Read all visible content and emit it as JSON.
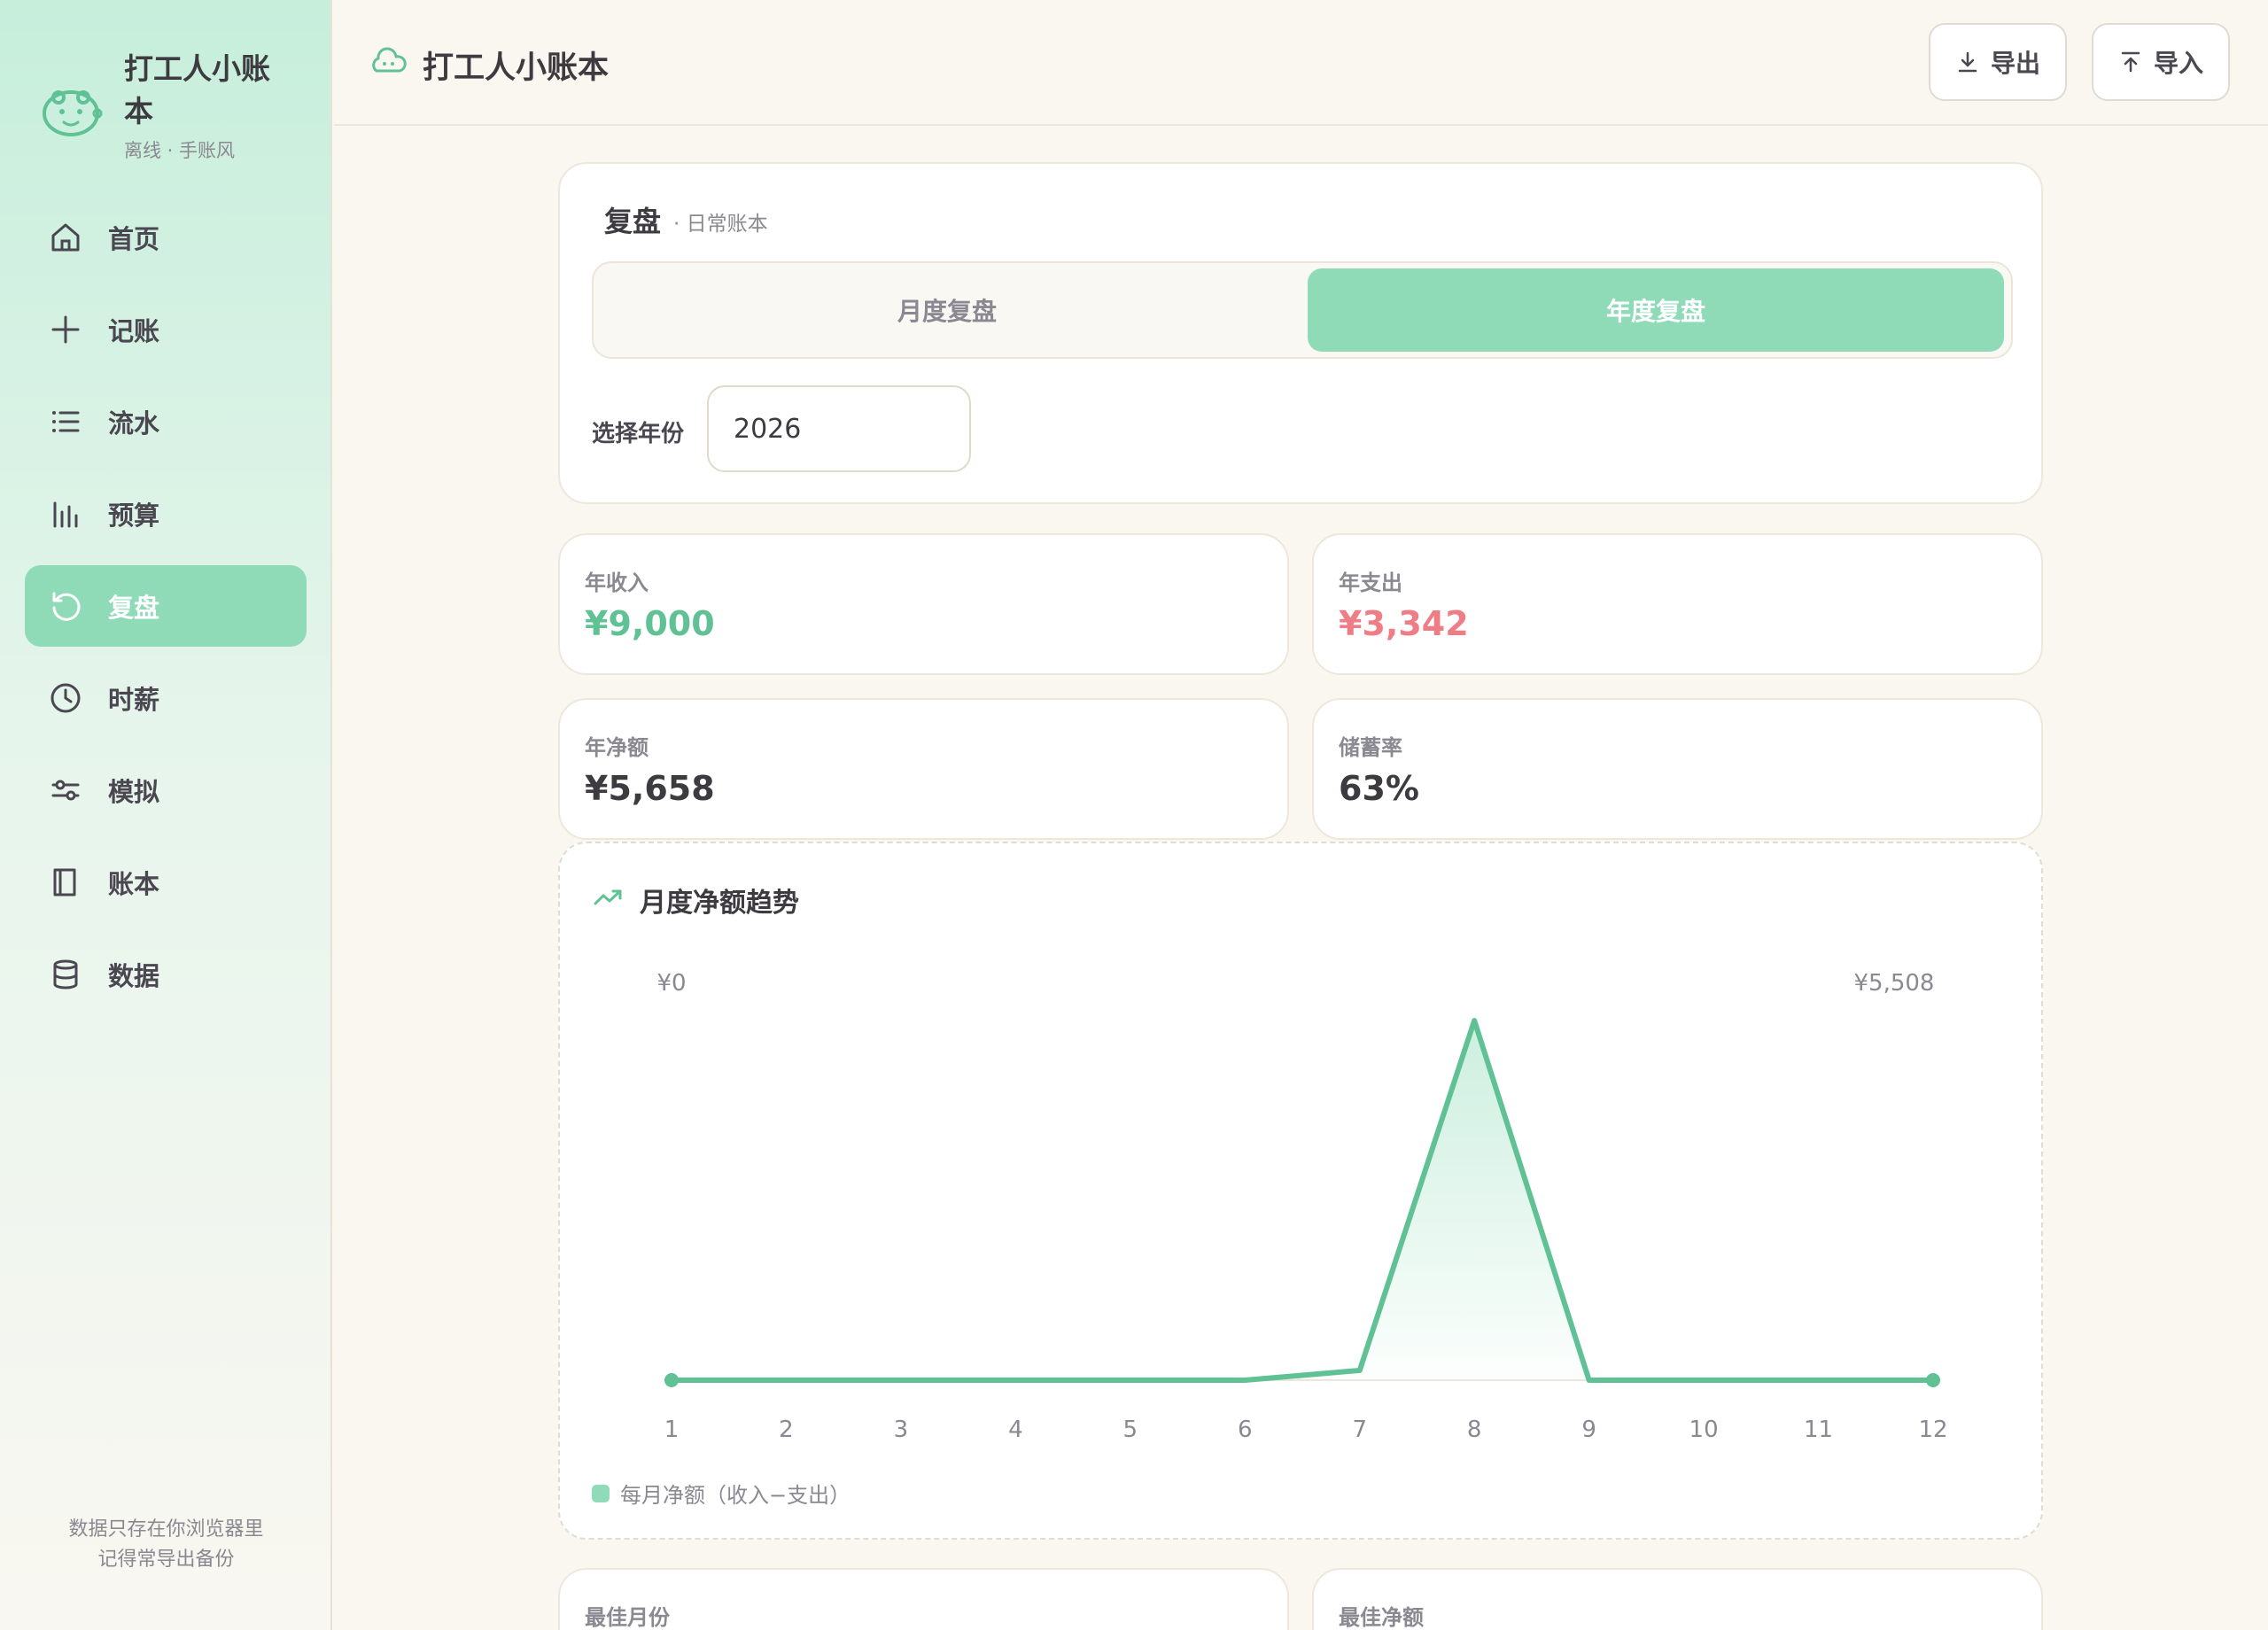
{
  "brand": {
    "title": "打工人小账本",
    "subtitle": "离线 · 手账风",
    "logo_icon": "smiley-face-icon"
  },
  "nav": [
    {
      "label": "首页",
      "icon": "home-icon",
      "active": false
    },
    {
      "label": "记账",
      "icon": "plus-icon",
      "active": false
    },
    {
      "label": "流水",
      "icon": "list-icon",
      "active": false
    },
    {
      "label": "预算",
      "icon": "bar-chart-icon",
      "active": false
    },
    {
      "label": "复盘",
      "icon": "refresh-icon",
      "active": true
    },
    {
      "label": "时薪",
      "icon": "clock-icon",
      "active": false
    },
    {
      "label": "模拟",
      "icon": "sliders-icon",
      "active": false
    },
    {
      "label": "账本",
      "icon": "book-icon",
      "active": false
    },
    {
      "label": "数据",
      "icon": "database-icon",
      "active": false
    }
  ],
  "sidebar_footer": {
    "line1": "数据只存在你浏览器里",
    "line2": "记得常导出备份"
  },
  "header": {
    "title": "打工人小账本",
    "export_label": "导出",
    "import_label": "导入"
  },
  "review": {
    "title": "复盘",
    "subtitle": "· 日常账本",
    "tabs": [
      {
        "label": "月度复盘",
        "active": false
      },
      {
        "label": "年度复盘",
        "active": true
      }
    ],
    "year_label": "选择年份",
    "year_value": "2026"
  },
  "stats": [
    {
      "label": "年收入",
      "value": "¥9,000",
      "color": "#5fc194"
    },
    {
      "label": "年支出",
      "value": "¥3,342",
      "color": "#ef7d86"
    },
    {
      "label": "年净额",
      "value": "¥5,658",
      "color": "#3d3a40"
    },
    {
      "label": "储蓄率",
      "value": "63%",
      "color": "#3d3a40"
    }
  ],
  "bottom_stats": [
    {
      "label": "最佳月份"
    },
    {
      "label": "最佳净额"
    }
  ],
  "colors": {
    "accent": "#8fdbb8",
    "line": "#5fc194",
    "income": "#5fc194",
    "expense": "#ef7d86"
  },
  "chart_data": {
    "type": "area",
    "title": "月度净额趋势",
    "y_min_label": "¥0",
    "y_max_label": "¥5,508",
    "ylim": [
      0,
      5508
    ],
    "x": [
      "1",
      "2",
      "3",
      "4",
      "5",
      "6",
      "7",
      "8",
      "9",
      "10",
      "11",
      "12"
    ],
    "series": [
      {
        "name": "每月净额（收入−支出）",
        "values": [
          0,
          0,
          0,
          0,
          0,
          0,
          150,
          5508,
          0,
          0,
          0,
          0
        ]
      }
    ],
    "grid": false,
    "legend": "bottom-left"
  }
}
